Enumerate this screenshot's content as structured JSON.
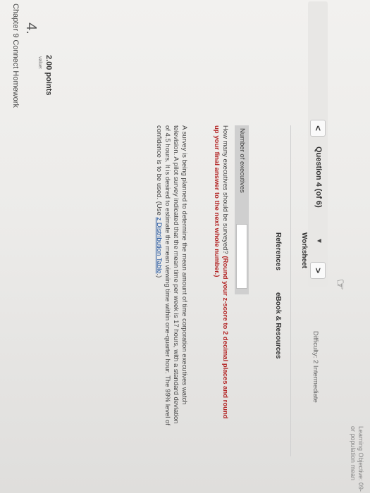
{
  "header": {
    "chapter_title": "Chapter 9 Connect Homework",
    "question_number": "4.",
    "value_label": "value:",
    "points": "2.00 points"
  },
  "question_nav": {
    "prev_label": "<",
    "position_label": "Question 4 (of 6)",
    "dropdown_caret": "▼",
    "next_label": ">"
  },
  "problem": {
    "text_before_link": "A survey is being planned to determine the mean amount of time corporation executives watch television. A pilot survey indicated that the mean time per week is 17 hours, with a standard deviation of 4.5 hours. It is desired to estimate the mean viewing time within one-quarter hour. The 99% level of confidence is to be used. (Use ",
    "link_text": "z Distribution Table",
    "text_after_link": ".)",
    "question": "How many executives should be surveyed?",
    "instruction": "(Round your z-score to 2 decimal places and round up your final answer to the next whole number.)"
  },
  "answer": {
    "label": "Number of executives",
    "value": ""
  },
  "tabs": {
    "references": "References",
    "ebook": "eBook & Resources"
  },
  "footer": {
    "worksheet": "Worksheet",
    "difficulty": "Difficulty: 2 Intermediate",
    "learning_objective_line1": "Learning Objective: 09-",
    "learning_objective_line2": "or population mean"
  },
  "colors": {
    "emphasis": "#b22222",
    "link": "#1a4f9c"
  }
}
